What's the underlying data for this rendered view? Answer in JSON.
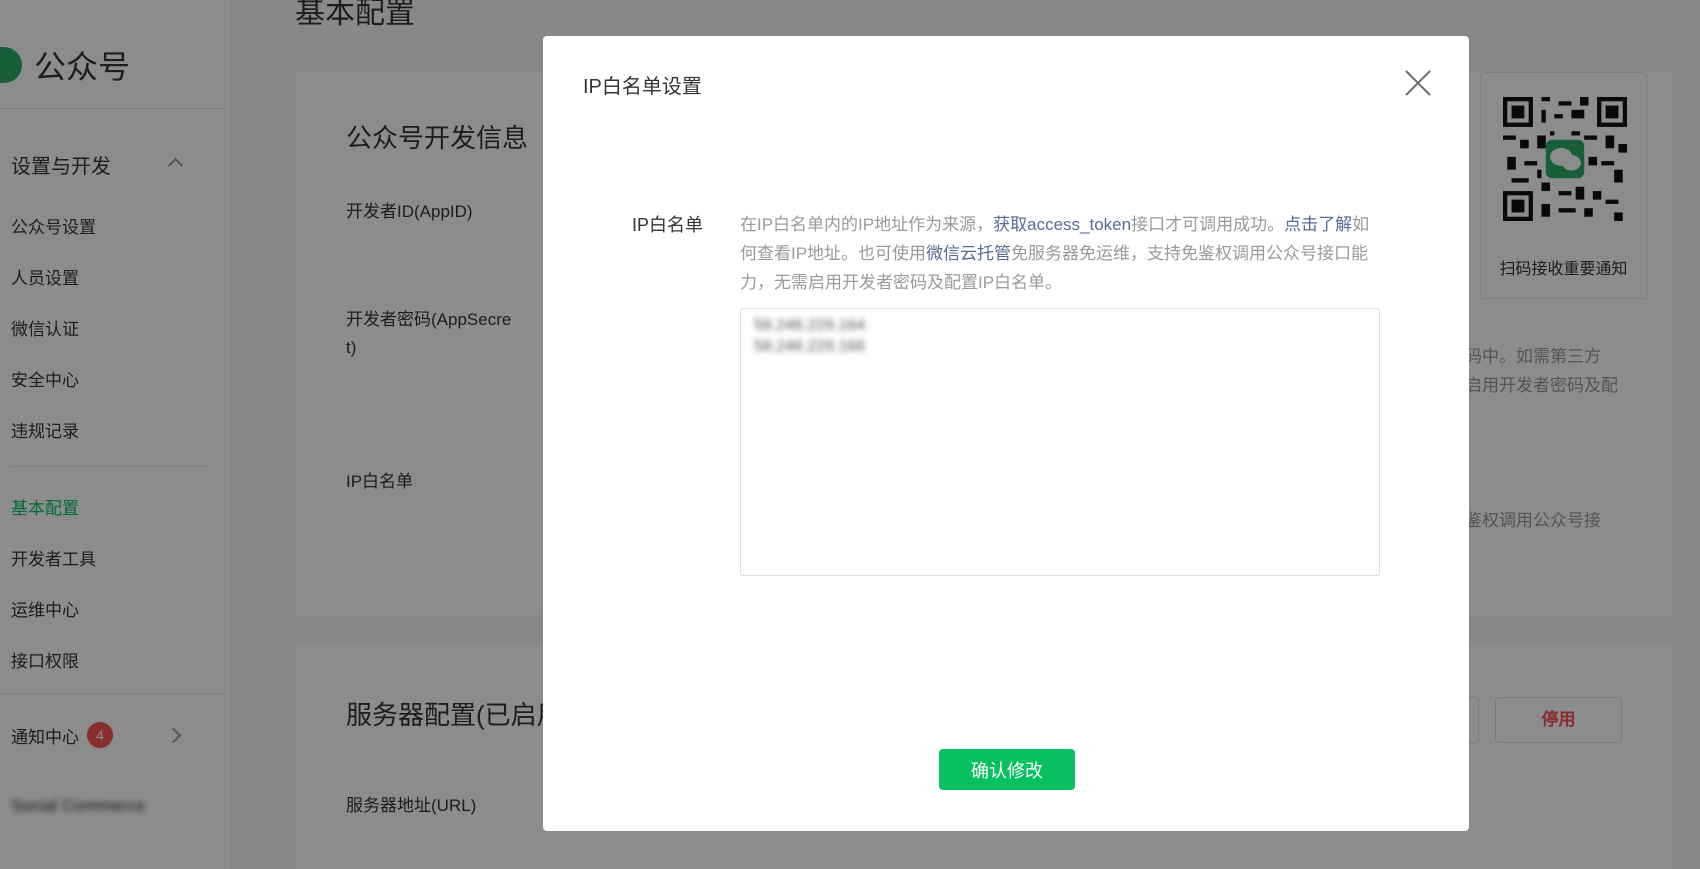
{
  "sidebar": {
    "brand": "公众号",
    "group_settings": "设置与开发",
    "items_settings": [
      "公众号设置",
      "人员设置",
      "微信认证",
      "安全中心",
      "违规记录"
    ],
    "items_dev": [
      "基本配置",
      "开发者工具",
      "运维中心",
      "接口权限"
    ],
    "notify": "通知中心",
    "notify_count": "4",
    "social": "Social Commerce"
  },
  "main": {
    "page_title": "基本配置",
    "dev_card": {
      "title": "公众号开发信息",
      "label_appid": "开发者ID(AppID)",
      "label_secret": "开发者密码(AppSecret)",
      "label_ip": "IP白名单",
      "desc_fragment_1": "码中。如需第三方",
      "desc_fragment_2": "启用开发者密码及配",
      "desc_fragment_3": "鉴权调用公众号接"
    },
    "server_card": {
      "title": "服务器配置(已启用)",
      "label_url": "服务器地址(URL)",
      "btn_disable": "停用"
    },
    "qr_caption": "扫码接收重要通知"
  },
  "dialog": {
    "title": "IP白名单设置",
    "field_label": "IP白名单",
    "desc": {
      "t1": "在IP白名单内的IP地址作为来源，",
      "link1": "获取access_token",
      "t2": "接口才可调用成功。",
      "link2": "点击了解",
      "t3": "如何查看IP地址。也可使用",
      "link3": "微信云托管",
      "t4": "免服务器免运维，支持免鉴权调用公众号接口能力，无需启用开发者密码及配置IP白名单。"
    },
    "ip_values": [
      "58.246.229.164",
      "58.246.229.166"
    ],
    "confirm_label": "确认修改"
  },
  "colors": {
    "primary": "#07c160",
    "link": "#576b95",
    "danger": "#fa5151"
  },
  "icons": {
    "close": "close-icon",
    "qr": "qr-code-icon",
    "wechat": "wechat-icon"
  }
}
